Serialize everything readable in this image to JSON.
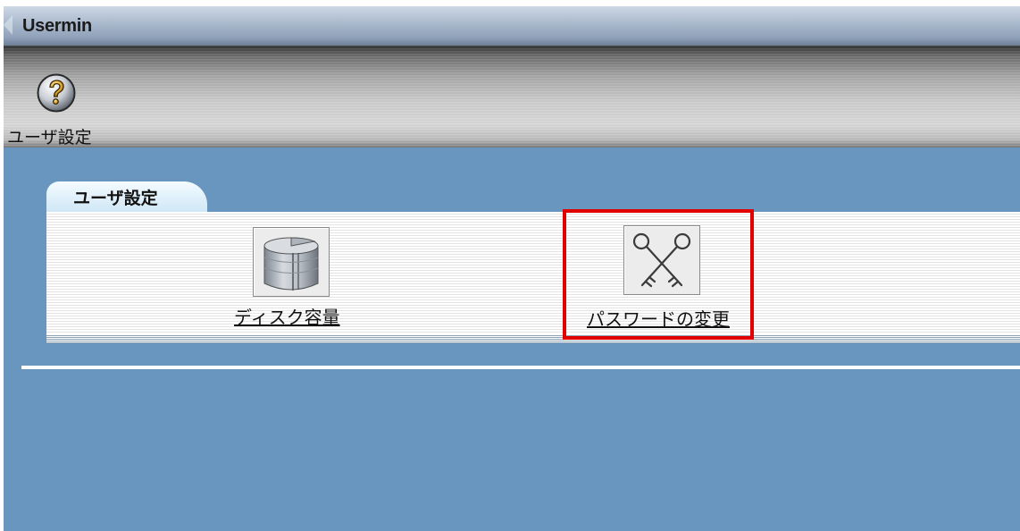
{
  "window": {
    "app_title": "Usermin"
  },
  "toolbar": {
    "help_button": {
      "label": "ユーザ設定",
      "icon": "help-question-icon"
    }
  },
  "section": {
    "tab_label": "ユーザ設定",
    "modules": [
      {
        "label": "ディスク容量",
        "icon": "disk-cylinder-icon"
      },
      {
        "label": "パスワードの変更",
        "icon": "crossed-keys-icon",
        "highlighted": true
      }
    ]
  },
  "colors": {
    "background": "#6996be",
    "highlight": "#e00000",
    "tab": "#cfe7f6"
  }
}
